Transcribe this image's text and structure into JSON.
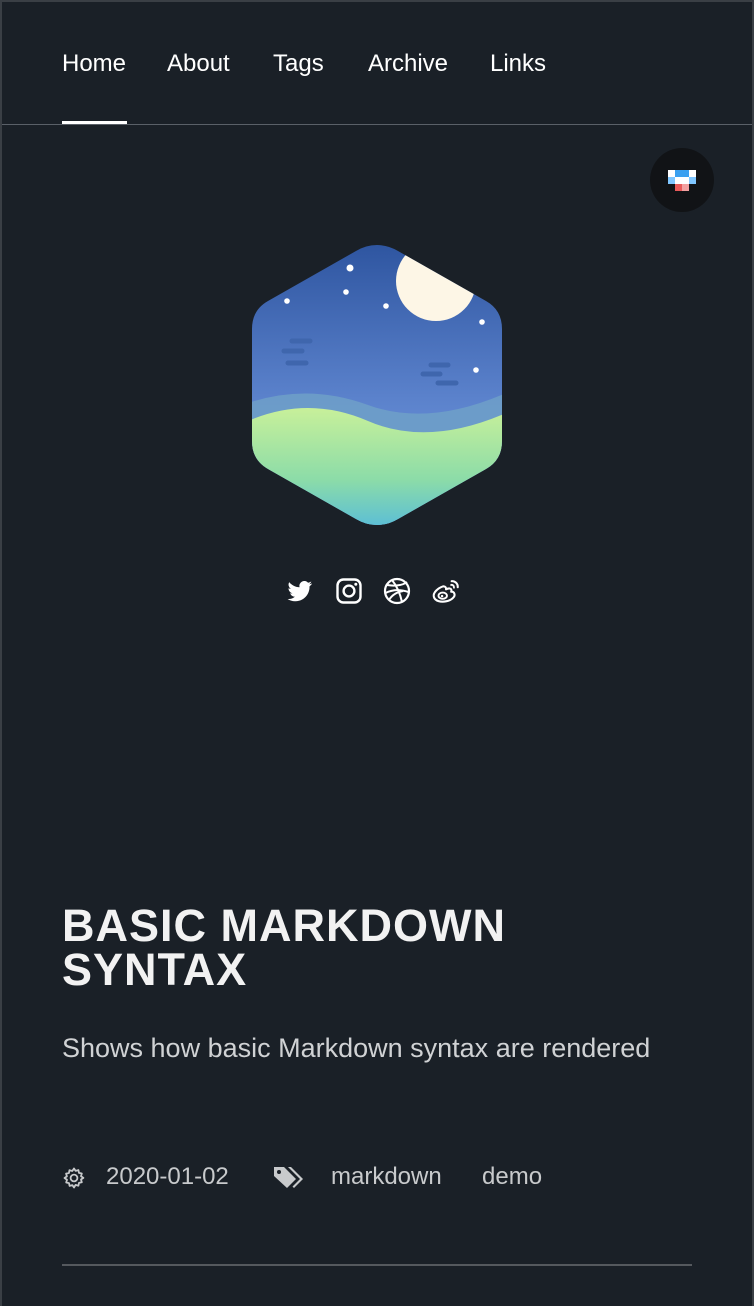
{
  "nav": {
    "items": [
      {
        "label": "Home",
        "active": true
      },
      {
        "label": "About"
      },
      {
        "label": "Tags"
      },
      {
        "label": "Archive"
      },
      {
        "label": "Links"
      }
    ]
  },
  "theme_toggle": {
    "icon": "theme-toggle-icon"
  },
  "avatar": {
    "icon": "night-landscape-hexagon-avatar"
  },
  "social": [
    {
      "icon": "twitter-icon"
    },
    {
      "icon": "instagram-icon"
    },
    {
      "icon": "dribbble-icon"
    },
    {
      "icon": "weibo-icon"
    }
  ],
  "post": {
    "title": "Basic Markdown Syntax",
    "description": "Shows how basic Markdown syntax are rendered",
    "date": "2020-01-02",
    "tags": [
      "markdown",
      "demo"
    ]
  },
  "colors": {
    "background": "#1a2027",
    "text": "#ffffff",
    "divider": "#55595e"
  }
}
